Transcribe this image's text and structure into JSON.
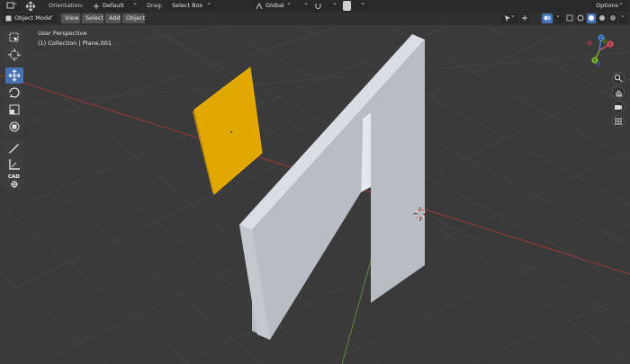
{
  "toolbar": {
    "orientation_label": "Orientation:",
    "orientation_value": "Default",
    "drag_label": "Drag:",
    "drag_value": "Select Box",
    "transform_value": "Global",
    "options_label": "Options"
  },
  "header": {
    "mode_label": "Object Mode",
    "menus": [
      "View",
      "Select",
      "Add",
      "Object"
    ]
  },
  "viewport": {
    "perspective_label": "User Perspective",
    "collection_label": "(1) Collection | Plane.001"
  },
  "tools": [
    {
      "name": "select-box-tool",
      "active": false
    },
    {
      "name": "cursor-tool",
      "active": false
    },
    {
      "name": "move-tool",
      "active": true
    },
    {
      "name": "rotate-tool",
      "active": false
    },
    {
      "name": "scale-tool",
      "active": false
    },
    {
      "name": "transform-tool",
      "active": false
    },
    {
      "name": "annotate-tool",
      "active": false
    },
    {
      "name": "measure-tool",
      "active": false
    },
    {
      "name": "cad-tool",
      "active": false
    }
  ],
  "cad_label": "CAD",
  "gizmo": {
    "x_label": "X",
    "y_label": "Y",
    "z_label": "Z",
    "x_color": "#e14d61",
    "y_color": "#7fb22a",
    "z_color": "#4a84dd"
  },
  "colors": {
    "selected": "#e0a800",
    "grid_red": "#9a3a3a",
    "grid_green": "#6c8a3a",
    "background": "#3a3a3a"
  }
}
